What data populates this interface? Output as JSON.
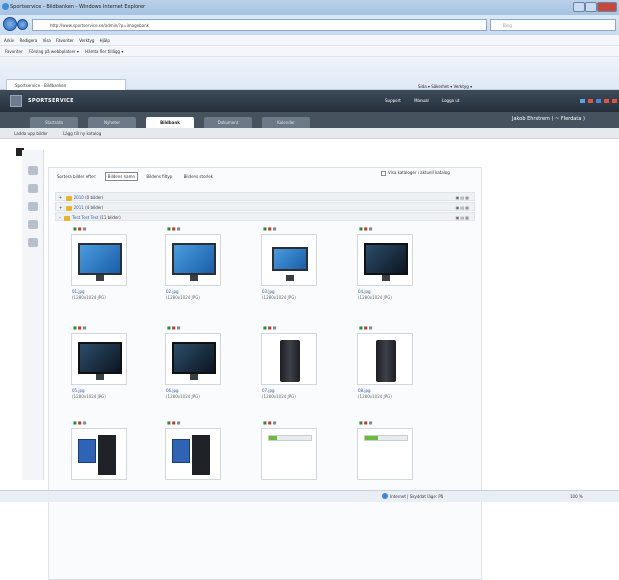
{
  "browser": {
    "title": "Sportservice - Bildbanken - Windows Internet Explorer",
    "address": "http://www.sportservice.se/admin/?p=imagebank",
    "search_placeholder": "Bing",
    "menu": [
      "Arkiv",
      "Redigera",
      "Visa",
      "Favoriter",
      "Verktyg",
      "Hjälp"
    ],
    "favorites": [
      "Favoriter",
      "Förslag på webbplatser ▾",
      "Hämta fler tillägg ▾"
    ],
    "tab_label": "Sportservice - Bildbanken",
    "command_bar": "Sida ▾   Säkerhet ▾   Verktyg ▾"
  },
  "app": {
    "name": "SPORTSERVICE",
    "topnav": [
      "Support",
      "Manual",
      "Logga ut"
    ],
    "tabs": [
      "Startsida",
      "Nyheter",
      "Bildbank",
      "Dokument",
      "Kalender"
    ],
    "active_tab": "Bildbank",
    "user": "Jakob Ehrstrem  ( ~ Flerdata )",
    "subnav": [
      "Ladda upp bilder",
      "Lägg till ny katalog"
    ]
  },
  "toolbar": {
    "buttons": [
      "Sortera bilder efter:",
      "Bildens namn",
      "Bildens filtyp",
      "Bildens storlek"
    ],
    "active": "Bildens namn",
    "show_subfolders": "Visa kataloger i aktuell katalog"
  },
  "folders": [
    {
      "name": "2010",
      "count": "(0 bilder)"
    },
    {
      "name": "2011",
      "count": "(4 bilder)"
    },
    {
      "name": "Test Test Test",
      "count": "(11 bilder)"
    }
  ],
  "images": [
    {
      "name": "01.jpg",
      "meta": "(1280x1024 JPG)",
      "kind": "mon"
    },
    {
      "name": "02.jpg",
      "meta": "(1280x1024 JPG)",
      "kind": "mon"
    },
    {
      "name": "03.jpg",
      "meta": "(1280x1024 JPG)",
      "kind": "mon-small"
    },
    {
      "name": "04.jpg",
      "meta": "(1280x1024 JPG)",
      "kind": "mon-dark"
    },
    {
      "name": "05.jpg",
      "meta": "(1280x1024 JPG)",
      "kind": "mon-dark"
    },
    {
      "name": "06.jpg",
      "meta": "(1280x1024 JPG)",
      "kind": "mon-dark"
    },
    {
      "name": "07.jpg",
      "meta": "(1280x1024 JPG)",
      "kind": "pc"
    },
    {
      "name": "08.jpg",
      "meta": "(1280x1024 JPG)",
      "kind": "pc"
    },
    {
      "name": "",
      "meta": "",
      "kind": "box"
    },
    {
      "name": "",
      "meta": "",
      "kind": "box"
    },
    {
      "name": "",
      "meta": "",
      "kind": "prog",
      "progress": 0.2
    },
    {
      "name": "",
      "meta": "",
      "kind": "prog",
      "progress": 0.3
    }
  ],
  "status": {
    "zone": "Internet | Skyddat läge: På",
    "zoom": "100 %"
  }
}
